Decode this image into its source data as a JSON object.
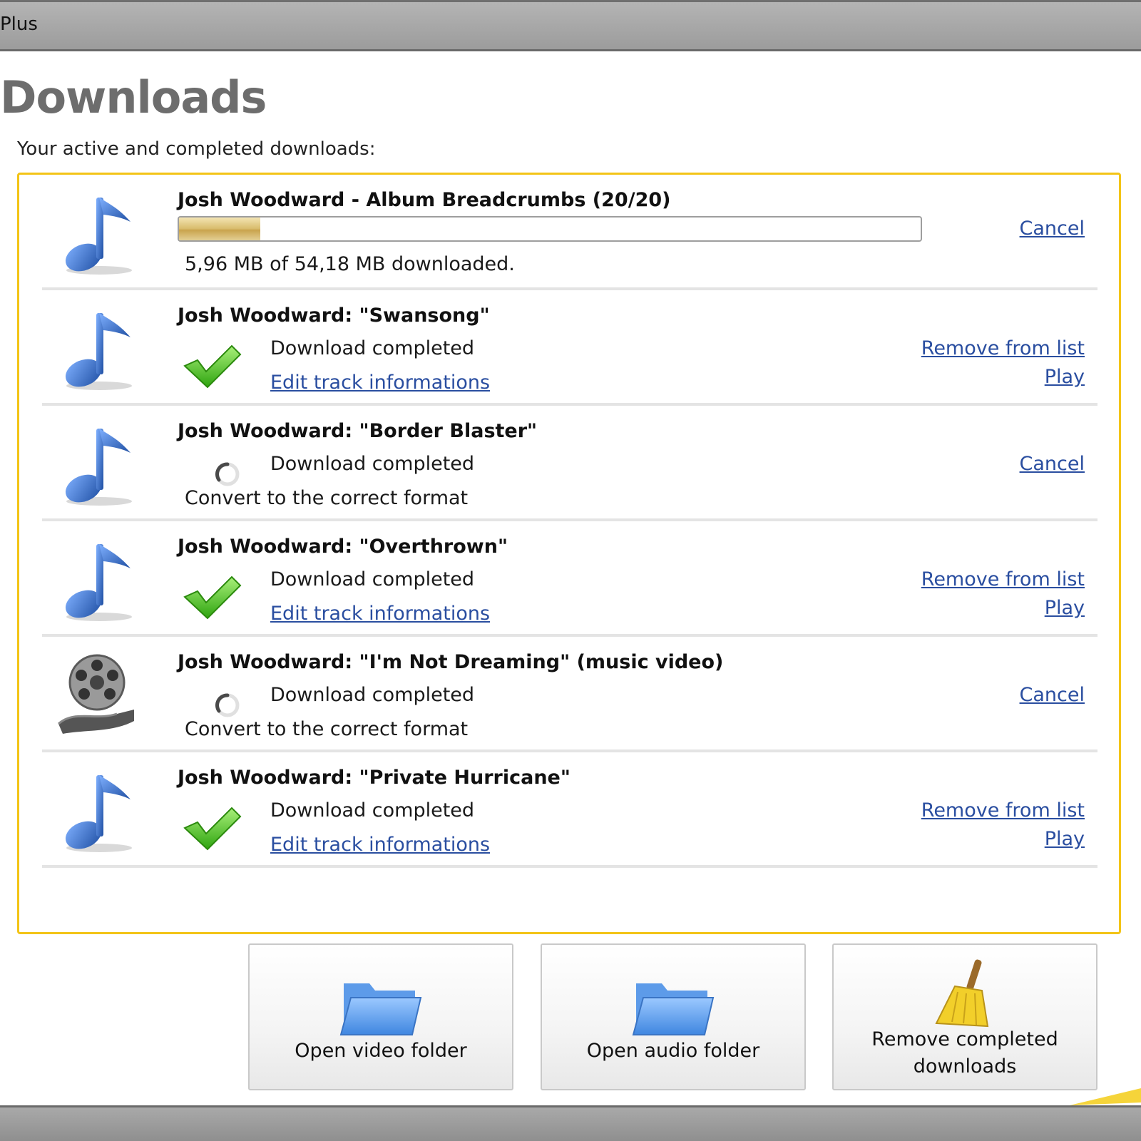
{
  "window": {
    "title": "Plus"
  },
  "page": {
    "heading": "Downloads",
    "subtitle": "Your active and completed downloads:"
  },
  "album": {
    "title": "Josh Woodward - Album Breadcrumbs (20/20)",
    "progress_fraction": 0.11,
    "downloaded_text": "5,96 MB of 54,18 MB downloaded.",
    "cancel_label": "Cancel"
  },
  "downloads": [
    {
      "title": "Josh Woodward: \"Swansong\"",
      "type": "audio",
      "state": "completed",
      "status": "Download completed",
      "sublink": "Edit track informations",
      "action1": "Remove from list",
      "action2": "Play"
    },
    {
      "title": "Josh Woodward: \"Border Blaster\"",
      "type": "audio",
      "state": "converting",
      "status": "Download completed",
      "subtext": "Convert to the correct format",
      "action1": "Cancel"
    },
    {
      "title": "Josh Woodward: \"Overthrown\"",
      "type": "audio",
      "state": "completed",
      "status": "Download completed",
      "sublink": "Edit track informations",
      "action1": "Remove from list",
      "action2": "Play"
    },
    {
      "title": "Josh Woodward: \"I'm Not Dreaming\" (music video)",
      "type": "video",
      "state": "converting",
      "status": "Download completed",
      "subtext": "Convert to the correct format",
      "action1": "Cancel"
    },
    {
      "title": "Josh Woodward: \"Private Hurricane\"",
      "type": "audio",
      "state": "completed",
      "status": "Download completed",
      "sublink": "Edit track informations",
      "action1": "Remove from list",
      "action2": "Play"
    }
  ],
  "buttons": {
    "open_video": "Open video folder",
    "open_audio": "Open audio folder",
    "remove_completed": "Remove completed downloads"
  },
  "icons": {
    "audio": "music-note-icon",
    "video": "film-reel-icon",
    "completed": "checkmark-icon",
    "converting": "spinner-icon",
    "folder": "folder-icon",
    "broom": "broom-icon"
  },
  "colors": {
    "panel_border": "#f3c417",
    "link": "#2a4ea0",
    "check": "#4fc21c",
    "note": "#3b6bc0"
  }
}
